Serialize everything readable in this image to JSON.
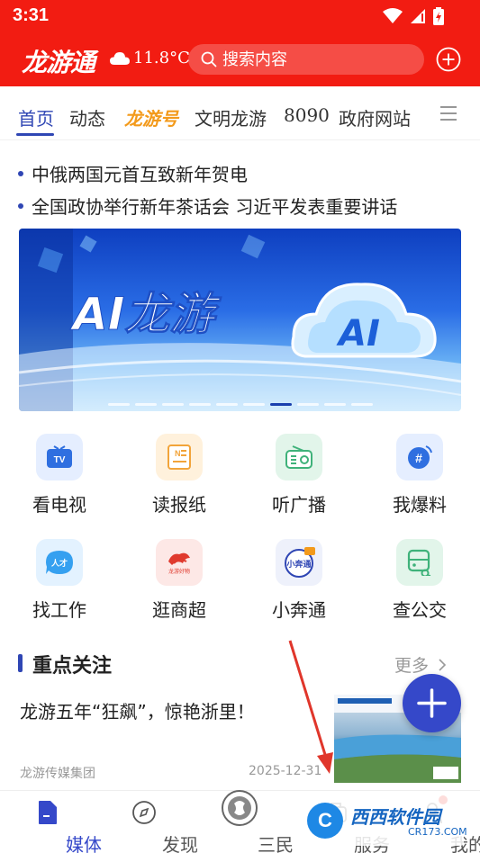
{
  "status_bar": {
    "time": "3:31"
  },
  "header": {
    "logo_text": "龙游通",
    "weather_temp": "11.8°C",
    "search_placeholder": "搜索内容"
  },
  "tabs": [
    {
      "label": "首页",
      "active": true
    },
    {
      "label": "动态"
    },
    {
      "label": "龙游号",
      "special": true
    },
    {
      "label": "文明龙游"
    },
    {
      "label": "8090"
    },
    {
      "label": "政府网站"
    }
  ],
  "headlines": [
    "中俄两国元首互致新年贺电",
    "全国政协举行新年茶话会 习近平发表重要讲话"
  ],
  "banner": {
    "title_text": "AI龙游",
    "cloud_text": "AI",
    "slide_count": 10,
    "active_slide": 7
  },
  "services": [
    {
      "label": "看电视",
      "icon": "tv-icon"
    },
    {
      "label": "读报纸",
      "icon": "newspaper-icon"
    },
    {
      "label": "听广播",
      "icon": "radio-icon"
    },
    {
      "label": "我爆料",
      "icon": "report-icon"
    },
    {
      "label": "找工作",
      "icon": "job-icon"
    },
    {
      "label": "逛商超",
      "icon": "shopping-icon"
    },
    {
      "label": "小奔通",
      "icon": "xiaobentong-icon"
    },
    {
      "label": "查公交",
      "icon": "bus-icon"
    }
  ],
  "section": {
    "title": "重点关注",
    "more_label": "更多",
    "article": {
      "title": "龙游五年“狂飙”，惊艳浙里！",
      "source": "龙游传媒集团",
      "date": "2025-12-31"
    }
  },
  "bottom_nav": [
    {
      "label": "媒体",
      "icon": "media-icon",
      "active": true
    },
    {
      "label": "发现",
      "icon": "compass-icon"
    },
    {
      "label": "三民",
      "icon": "sanmin-icon"
    },
    {
      "label": "服务",
      "icon": "service-icon"
    },
    {
      "label": "我的",
      "icon": "profile-icon"
    }
  ],
  "watermark": {
    "text": "西西软件园",
    "sub": "CR173.COM"
  },
  "colors": {
    "brand_red": "#f21c12",
    "accent_blue": "#2f46b4",
    "tab_special": "#f39a1b"
  }
}
